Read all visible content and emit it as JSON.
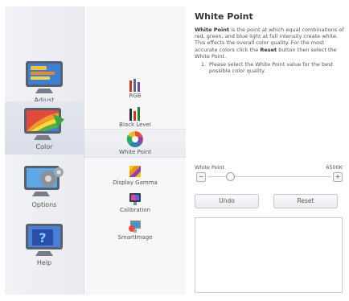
{
  "categories": [
    {
      "label": "Adjust",
      "icon": "adjust-monitor-icon"
    },
    {
      "label": "Color",
      "icon": "color-monitor-icon"
    },
    {
      "label": "Options",
      "icon": "options-monitor-icon"
    },
    {
      "label": "Help",
      "icon": "help-monitor-icon"
    }
  ],
  "subitems": [
    {
      "label": "RGB",
      "icon": "rgb-bars-icon"
    },
    {
      "label": "Black Level",
      "icon": "black-level-bars-icon"
    },
    {
      "label": "White Point",
      "icon": "white-point-color-wheel-icon"
    },
    {
      "label": "Display Gamma",
      "icon": "display-gamma-icon"
    },
    {
      "label": "Calibration",
      "icon": "calibration-icon"
    },
    {
      "label": "SmartImage",
      "icon": "smartimage-icon"
    }
  ],
  "panel": {
    "title": "White Point",
    "desc_term": "White Point",
    "desc_1": " is the point at which equal combinations of red, green, and blue light at full intensity create white. This effects the overall color quality. For the most accurate colors click the ",
    "desc_reset": "Reset",
    "desc_2": " button then select the White Point.",
    "step_num": "1.",
    "step_text": "Please select the White Point value for the best possible color quality.",
    "slider_label": "White Point",
    "slider_value": "6500K",
    "slider_level": 0.18,
    "minus": "−",
    "plus": "+",
    "undo": "Undo",
    "reset": "Reset"
  }
}
